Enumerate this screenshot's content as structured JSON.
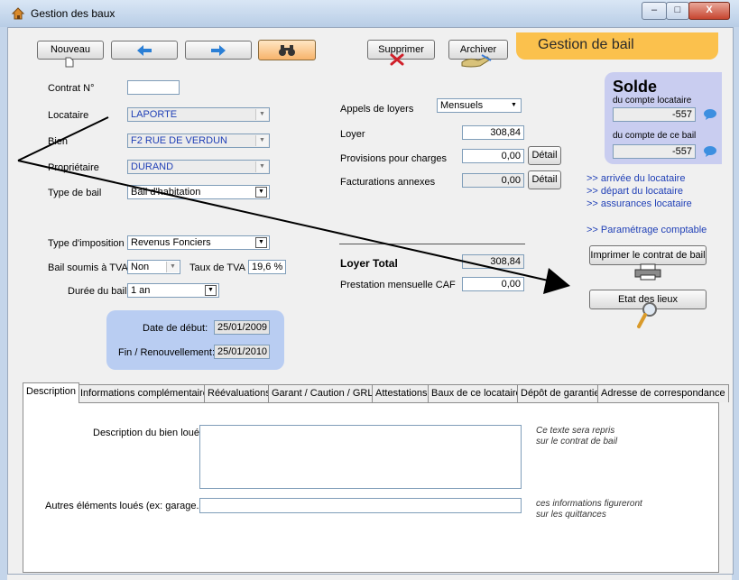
{
  "window": {
    "title": "Gestion des baux",
    "minimize": "–",
    "maximize": "□",
    "close": "X"
  },
  "toolbar": {
    "new_label": "Nouveau",
    "delete_label": "Supprimer",
    "archive_label": "Archiver"
  },
  "header_banner": "Gestion de bail",
  "contract": {
    "contract_no_label": "Contrat N°",
    "contract_no": "",
    "tenant_label": "Locataire",
    "tenant": "LAPORTE",
    "property_label": "Bien",
    "property": "F2 RUE DE VERDUN",
    "owner_label": "Propriétaire",
    "owner": "DURAND",
    "lease_type_label": "Type de bail",
    "lease_type": "Bail d'habitation",
    "tax_type_label": "Type d'imposition",
    "tax_type": "Revenus Fonciers",
    "vat_label": "Bail soumis à TVA",
    "vat": "Non",
    "vat_rate_label": "Taux de TVA",
    "vat_rate": "19,6 %",
    "duration_label": "Durée du bail",
    "duration": "1 an"
  },
  "dates": {
    "start_label": "Date de début:",
    "start": "25/01/2009",
    "end_label": "Fin / Renouvellement:",
    "end": "25/01/2010"
  },
  "rent": {
    "calls_label": "Appels de loyers",
    "calls": "Mensuels",
    "rent_label": "Loyer",
    "rent": "308,84",
    "charges_label": "Provisions pour charges",
    "charges": "0,00",
    "fees_label": "Facturations annexes",
    "fees": "0,00",
    "detail_label": "Détail",
    "total_label": "Loyer Total",
    "total": "308,84",
    "caf_label": "Prestation mensuelle CAF",
    "caf": "0,00"
  },
  "balance": {
    "title": "Solde",
    "tenant_account_label": "du compte locataire",
    "tenant_account": "-557",
    "lease_account_label": "du compte de ce bail",
    "lease_account": "-557"
  },
  "links": [
    ">> arrivée du locataire",
    ">> départ du locataire",
    ">> assurances locataire",
    ">> Paramétrage comptable"
  ],
  "actions": {
    "print_contract": "Imprimer le contrat de bail",
    "inventory": "Etat des lieux"
  },
  "tabs": [
    "Description",
    "Informations complémentaires",
    "Réévaluations",
    "Garant / Caution / GRL",
    "Attestations",
    "Baux de ce locataire",
    "Dépôt de garantie",
    "Adresse de correspondance"
  ],
  "description_tab": {
    "desc_label": "Description du bien loué:",
    "desc_note_1": "Ce texte sera repris",
    "desc_note_2": "sur le contrat de bail",
    "other_label": "Autres éléments loués (ex: garage...)",
    "other_note_1": "ces informations figureront",
    "other_note_2": "sur les quittances"
  },
  "colors": {
    "accent_orange": "#fbc14d",
    "date_panel": "#b9cdf2",
    "balance_panel": "#c9cdf0",
    "link": "#1f3fb6"
  }
}
